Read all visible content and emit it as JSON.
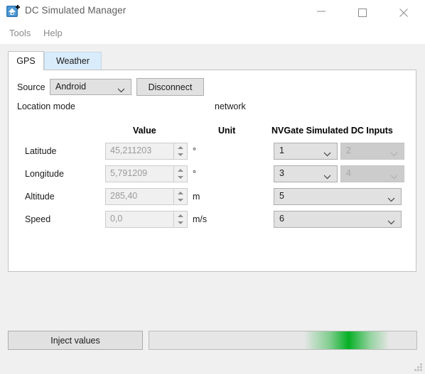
{
  "window": {
    "title": "DC Simulated Manager",
    "icon": "app-icon",
    "controls": {
      "minimize": "minimize-icon",
      "maximize": "maximize-icon",
      "close": "close-icon"
    }
  },
  "menubar": {
    "items": [
      {
        "label": "Tools"
      },
      {
        "label": "Help"
      }
    ]
  },
  "tabs": [
    {
      "label": "GPS",
      "active": true
    },
    {
      "label": "Weather",
      "active": false
    }
  ],
  "gps": {
    "source": {
      "label": "Source",
      "value": "Android",
      "disconnect_label": "Disconnect"
    },
    "location_mode": {
      "label": "Location mode",
      "value": "network"
    },
    "headers": {
      "value": "Value",
      "unit": "Unit",
      "inputs": "NVGate Simulated DC Inputs"
    },
    "rows": [
      {
        "label": "Latitude",
        "value": "45,211203",
        "unit": "°",
        "input_a": "1",
        "input_b": "2",
        "input_b_disabled": true,
        "wide": false
      },
      {
        "label": "Longitude",
        "value": "5,791209",
        "unit": "°",
        "input_a": "3",
        "input_b": "4",
        "input_b_disabled": true,
        "wide": false
      },
      {
        "label": "Altitude",
        "value": "285,40",
        "unit": "m",
        "input_a": "5",
        "input_b": null,
        "input_b_disabled": false,
        "wide": true
      },
      {
        "label": "Speed",
        "value": "0,0",
        "unit": "m/s",
        "input_a": "6",
        "input_b": null,
        "input_b_disabled": false,
        "wide": true
      }
    ]
  },
  "footer": {
    "inject_label": "Inject values",
    "progress": {
      "indeterminate": true,
      "accent_color": "#06b025"
    }
  },
  "colors": {
    "window_bg": "#f0f0f0",
    "panel_bg": "#ffffff",
    "titlebar_bg": "#ffffff",
    "tab_inactive_bg": "#d9ecfb",
    "control_bg": "#e1e1e1",
    "disabled_bg": "#cccccc",
    "progress_green": "#06b025"
  }
}
